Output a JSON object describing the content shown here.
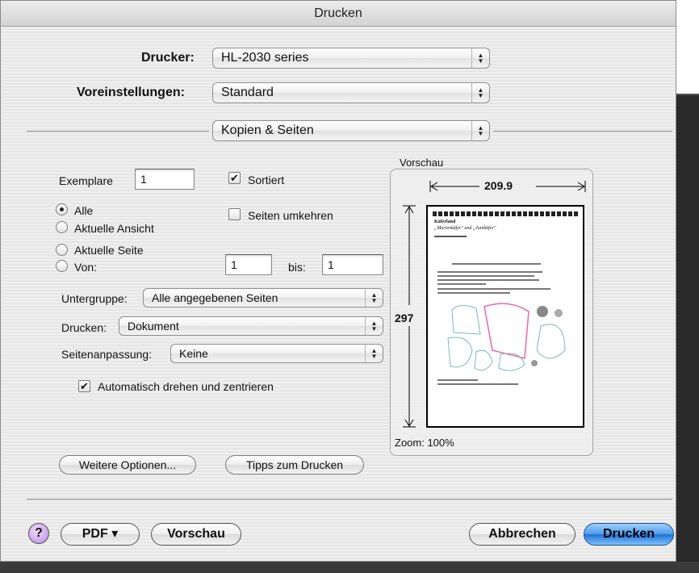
{
  "window": {
    "title": "Drucken"
  },
  "printer": {
    "label": "Drucker:",
    "value": "HL-2030 series"
  },
  "presets": {
    "label": "Voreinstellungen:",
    "value": "Standard"
  },
  "panel": {
    "value": "Kopien & Seiten"
  },
  "copies": {
    "label": "Exemplare",
    "value": "1",
    "collated": {
      "label": "Sortiert",
      "checked": true
    },
    "reverse": {
      "label": "Seiten umkehren",
      "checked": false
    }
  },
  "pages": {
    "options": [
      {
        "label": "Alle",
        "selected": true
      },
      {
        "label": "Aktuelle Ansicht",
        "selected": false
      },
      {
        "label": "Aktuelle Seite",
        "selected": false
      },
      {
        "label": "Von:",
        "selected": false
      }
    ],
    "from": "1",
    "to_label": "bis:",
    "to": "1"
  },
  "subset": {
    "label": "Untergruppe:",
    "value": "Alle angegebenen Seiten"
  },
  "print_what": {
    "label": "Drucken:",
    "value": "Dokument"
  },
  "page_scaling": {
    "label": "Seitenanpassung:",
    "value": "Keine"
  },
  "auto_rotate": {
    "label": "Automatisch drehen und zentrieren",
    "checked": true
  },
  "preview": {
    "label": "Vorschau",
    "width_dim": "209.9",
    "height_dim": "297",
    "zoom": "Zoom: 100%",
    "doc_title": "Käferland",
    "doc_subtitle": "„Marienkäfer\" und „Junikäfer\""
  },
  "buttons": {
    "more_options": "Weitere Optionen...",
    "print_tips": "Tipps zum Drucken",
    "help": "?",
    "pdf": "PDF ▾",
    "preview": "Vorschau",
    "cancel": "Abbrechen",
    "print": "Drucken"
  },
  "colors": {
    "default_button": "#3d8ee0",
    "help_button": "#c79bef"
  }
}
